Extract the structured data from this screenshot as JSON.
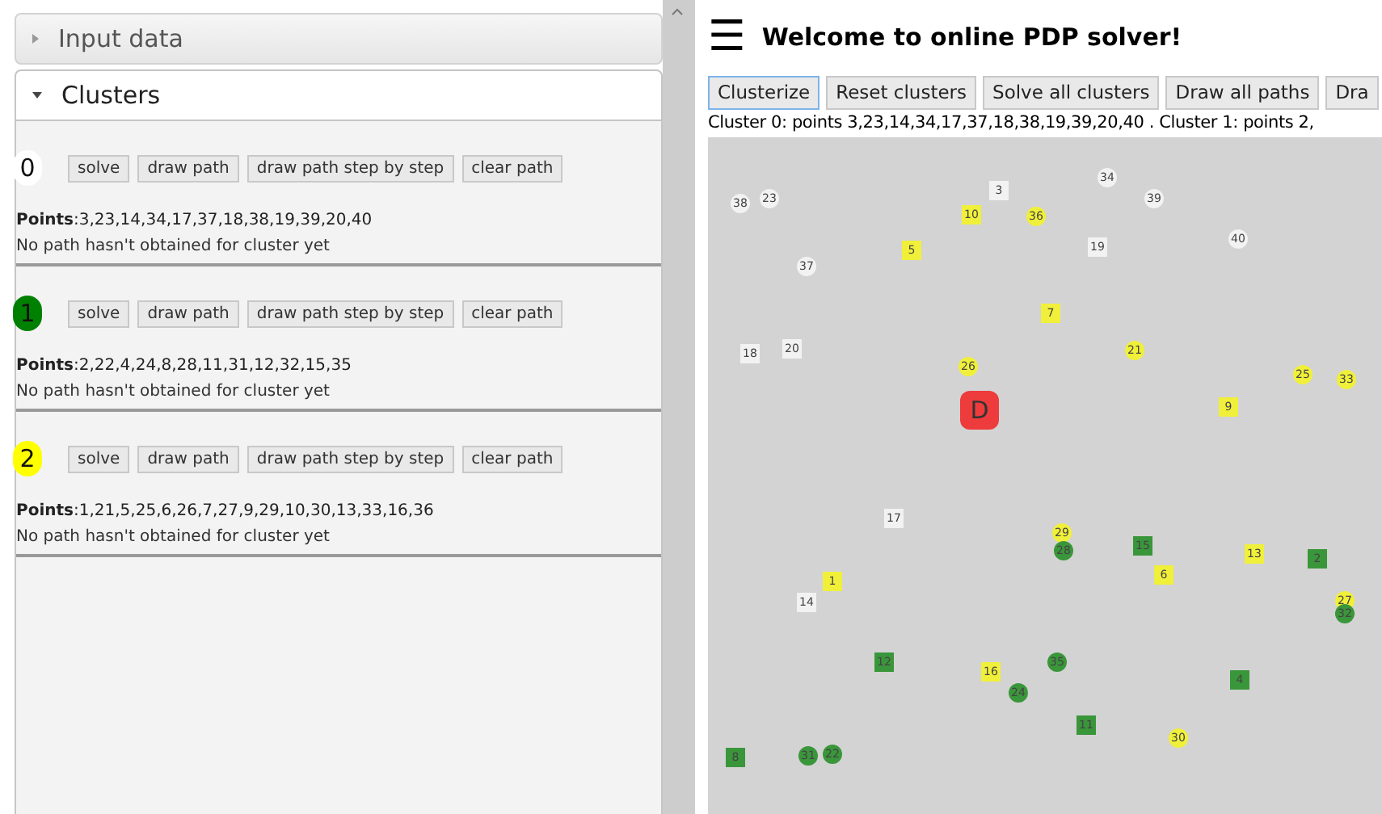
{
  "accordion": [
    {
      "label": "Input data",
      "expanded": false
    },
    {
      "label": "Clusters",
      "expanded": true
    }
  ],
  "clusters": [
    {
      "number": "0",
      "color": "#ffffff",
      "buttons": [
        "solve",
        "draw path",
        "draw path step by step",
        "clear path"
      ],
      "points_label": "Points",
      "points": ":3,23,14,34,17,37,18,38,19,39,20,40",
      "note": "No path hasn't obtained for cluster yet"
    },
    {
      "number": "1",
      "color": "#008000",
      "buttons": [
        "solve",
        "draw path",
        "draw path step by step",
        "clear path"
      ],
      "points_label": "Points",
      "points": ":2,22,4,24,8,28,11,31,12,32,15,35",
      "note": "No path hasn't obtained for cluster yet"
    },
    {
      "number": "2",
      "color": "#ffff00",
      "buttons": [
        "solve",
        "draw path",
        "draw path step by step",
        "clear path"
      ],
      "points_label": "Points",
      "points": ":1,21,5,25,6,26,7,27,9,29,10,30,13,33,16,36",
      "note": "No path hasn't obtained for cluster yet"
    }
  ],
  "header": {
    "menu": "☰",
    "title": "Welcome to online PDP solver!"
  },
  "toolbar": [
    {
      "label": "Clusterize",
      "focused": true
    },
    {
      "label": "Reset clusters",
      "focused": false
    },
    {
      "label": "Solve all clusters",
      "focused": false
    },
    {
      "label": "Draw all paths",
      "focused": false
    },
    {
      "label": "Dra",
      "focused": false
    }
  ],
  "summary": "Cluster 0: points 3,23,14,34,17,37,18,38,19,39,20,40 . Cluster 1: points 2,",
  "map": {
    "depot": "D",
    "points": [
      {
        "label": "34",
        "kind": "circle",
        "color": "#f2f2f2"
      },
      {
        "label": "3",
        "kind": "square",
        "color": "#f2f2f2"
      },
      {
        "label": "23",
        "kind": "circle",
        "color": "#f2f2f2"
      },
      {
        "label": "38",
        "kind": "circle",
        "color": "#f2f2f2"
      },
      {
        "label": "39",
        "kind": "circle",
        "color": "#f2f2f2"
      },
      {
        "label": "10",
        "kind": "square",
        "color": "#f0f03a"
      },
      {
        "label": "36",
        "kind": "circle",
        "color": "#f0f03a"
      },
      {
        "label": "40",
        "kind": "circle",
        "color": "#f2f2f2"
      },
      {
        "label": "5",
        "kind": "square",
        "color": "#f0f03a"
      },
      {
        "label": "19",
        "kind": "square",
        "color": "#f2f2f2"
      },
      {
        "label": "37",
        "kind": "circle",
        "color": "#f2f2f2"
      },
      {
        "label": "7",
        "kind": "square",
        "color": "#f0f03a"
      },
      {
        "label": "18",
        "kind": "square",
        "color": "#f2f2f2"
      },
      {
        "label": "20",
        "kind": "square",
        "color": "#f2f2f2"
      },
      {
        "label": "21",
        "kind": "circle",
        "color": "#f0f03a"
      },
      {
        "label": "26",
        "kind": "circle",
        "color": "#f0f03a"
      },
      {
        "label": "25",
        "kind": "circle",
        "color": "#f0f03a"
      },
      {
        "label": "33",
        "kind": "circle",
        "color": "#f0f03a"
      },
      {
        "label": "9",
        "kind": "square",
        "color": "#f0f03a"
      },
      {
        "label": "17",
        "kind": "square",
        "color": "#f2f2f2"
      },
      {
        "label": "29",
        "kind": "circle",
        "color": "#f0f03a"
      },
      {
        "label": "15",
        "kind": "square",
        "color": "#3a963a"
      },
      {
        "label": "28",
        "kind": "circle",
        "color": "#3a963a"
      },
      {
        "label": "13",
        "kind": "square",
        "color": "#f0f03a"
      },
      {
        "label": "2",
        "kind": "square",
        "color": "#3a963a"
      },
      {
        "label": "6",
        "kind": "square",
        "color": "#f0f03a"
      },
      {
        "label": "1",
        "kind": "square",
        "color": "#f0f03a"
      },
      {
        "label": "27",
        "kind": "circle",
        "color": "#f0f03a"
      },
      {
        "label": "14",
        "kind": "square",
        "color": "#f2f2f2"
      },
      {
        "label": "32",
        "kind": "circle",
        "color": "#3a963a"
      },
      {
        "label": "12",
        "kind": "square",
        "color": "#3a963a"
      },
      {
        "label": "35",
        "kind": "circle",
        "color": "#3a963a"
      },
      {
        "label": "16",
        "kind": "square",
        "color": "#f0f03a"
      },
      {
        "label": "4",
        "kind": "square",
        "color": "#3a963a"
      },
      {
        "label": "24",
        "kind": "circle",
        "color": "#3a963a"
      },
      {
        "label": "11",
        "kind": "square",
        "color": "#3a963a"
      },
      {
        "label": "30",
        "kind": "circle",
        "color": "#f0f03a"
      },
      {
        "label": "8",
        "kind": "square",
        "color": "#3a963a"
      },
      {
        "label": "31",
        "kind": "circle",
        "color": "#3a963a"
      },
      {
        "label": "22",
        "kind": "circle",
        "color": "#3a963a"
      }
    ]
  }
}
